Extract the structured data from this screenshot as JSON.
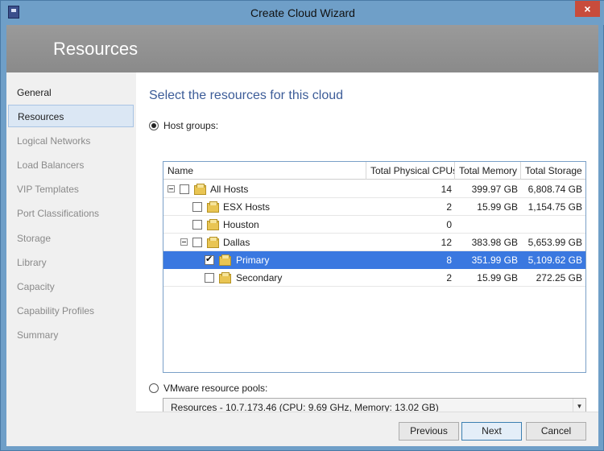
{
  "window": {
    "title": "Create Cloud Wizard",
    "close_glyph": "×"
  },
  "header": {
    "title": "Resources"
  },
  "nav": {
    "items": [
      {
        "label": "General",
        "state": "done"
      },
      {
        "label": "Resources",
        "state": "active"
      },
      {
        "label": "Logical Networks",
        "state": "pending"
      },
      {
        "label": "Load Balancers",
        "state": "pending"
      },
      {
        "label": "VIP Templates",
        "state": "pending"
      },
      {
        "label": "Port Classifications",
        "state": "pending"
      },
      {
        "label": "Storage",
        "state": "pending"
      },
      {
        "label": "Library",
        "state": "pending"
      },
      {
        "label": "Capacity",
        "state": "pending"
      },
      {
        "label": "Capability Profiles",
        "state": "pending"
      },
      {
        "label": "Summary",
        "state": "pending"
      }
    ]
  },
  "main": {
    "section_title": "Select the resources for this cloud",
    "host_groups_label": "Host groups:",
    "host_groups_selected": true,
    "vmware_label": "VMware resource pools:",
    "vmware_selected": false,
    "vmware_pool_value": "Resources - 10.7.173.46 (CPU: 9.69 GHz, Memory: 13.02 GB)"
  },
  "grid": {
    "columns": [
      "Name",
      "Total Physical CPUs",
      "Total Memory",
      "Total Storage"
    ],
    "rows": [
      {
        "name": "All Hosts",
        "cpus": "14",
        "memory": "399.97 GB",
        "storage": "6,808.74 GB",
        "checked": false,
        "selected": false
      },
      {
        "name": "ESX Hosts",
        "cpus": "2",
        "memory": "15.99 GB",
        "storage": "1,154.75 GB",
        "checked": false,
        "selected": false
      },
      {
        "name": "Houston",
        "cpus": "0",
        "memory": "",
        "storage": "",
        "checked": false,
        "selected": false
      },
      {
        "name": "Dallas",
        "cpus": "12",
        "memory": "383.98 GB",
        "storage": "5,653.99 GB",
        "checked": false,
        "selected": false
      },
      {
        "name": "Primary",
        "cpus": "8",
        "memory": "351.99 GB",
        "storage": "5,109.62 GB",
        "checked": true,
        "selected": true
      },
      {
        "name": "Secondary",
        "cpus": "2",
        "memory": "15.99 GB",
        "storage": "272.25 GB",
        "checked": false,
        "selected": false
      }
    ]
  },
  "footer": {
    "previous_label": "Previous",
    "next_label": "Next",
    "cancel_label": "Cancel"
  },
  "colors": {
    "titlebar": "#6f9fc8",
    "header_band": "#8f8f8f",
    "selection": "#3a78e0",
    "section_title": "#3c5c98"
  }
}
